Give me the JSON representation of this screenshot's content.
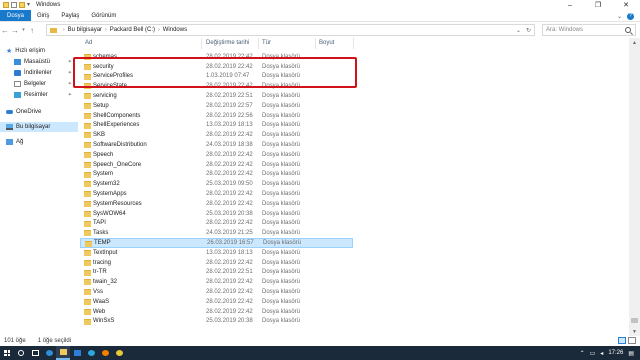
{
  "window": {
    "title": "Windows",
    "minimize_glyph": "–",
    "maximize_glyph": "❐",
    "close_glyph": "✕"
  },
  "ribbon": {
    "tabs": [
      {
        "label": "Dosya"
      },
      {
        "label": "Giriş"
      },
      {
        "label": "Paylaş"
      },
      {
        "label": "Görünüm"
      }
    ],
    "expand_glyph": "⌄",
    "help_glyph": "?"
  },
  "address_bar": {
    "crumbs": [
      "Bu bilgisayar",
      "Packard Bell (C:)",
      "Windows"
    ],
    "refresh_glyph": "↻"
  },
  "search": {
    "placeholder": "Ara: Windows"
  },
  "nav_pane": {
    "items": [
      {
        "label": "Hızlı erişim",
        "icon": "star-icon"
      },
      {
        "label": "Masaüstü",
        "icon": "desktop-icon",
        "pinned": true
      },
      {
        "label": "İndirilenler",
        "icon": "downloads-icon",
        "pinned": true
      },
      {
        "label": "Belgeler",
        "icon": "documents-icon",
        "pinned": true
      },
      {
        "label": "Resimler",
        "icon": "pictures-icon",
        "pinned": true
      },
      {
        "label": "OneDrive",
        "icon": "onedrive-icon"
      },
      {
        "label": "Bu bilgisayar",
        "icon": "this-pc-icon",
        "selected": true
      },
      {
        "label": "Ağ",
        "icon": "network-icon"
      }
    ]
  },
  "columns": {
    "name": "Ad",
    "date": "Değiştirme tarihi",
    "type": "Tür",
    "size": "Boyut"
  },
  "files": [
    {
      "name": "schemas",
      "date": "28.02.2019 22:42",
      "type": "Dosya klasörü"
    },
    {
      "name": "security",
      "date": "28.02.2019 22:42",
      "type": "Dosya klasörü"
    },
    {
      "name": "ServiceProfiles",
      "date": "1.03.2019 07:47",
      "type": "Dosya klasörü"
    },
    {
      "name": "ServiceState",
      "date": "28.02.2019 22:42",
      "type": "Dosya klasörü"
    },
    {
      "name": "servicing",
      "date": "28.02.2019 22:51",
      "type": "Dosya klasörü"
    },
    {
      "name": "Setup",
      "date": "28.02.2019 22:57",
      "type": "Dosya klasörü"
    },
    {
      "name": "ShellComponents",
      "date": "28.02.2019 22:56",
      "type": "Dosya klasörü"
    },
    {
      "name": "ShellExperiences",
      "date": "13.03.2019 18:13",
      "type": "Dosya klasörü"
    },
    {
      "name": "SKB",
      "date": "28.02.2019 22:42",
      "type": "Dosya klasörü"
    },
    {
      "name": "SoftwareDistribution",
      "date": "24.03.2019 18:38",
      "type": "Dosya klasörü"
    },
    {
      "name": "Speech",
      "date": "28.02.2019 22:42",
      "type": "Dosya klasörü"
    },
    {
      "name": "Speech_OneCore",
      "date": "28.02.2019 22:42",
      "type": "Dosya klasörü"
    },
    {
      "name": "System",
      "date": "28.02.2019 22:42",
      "type": "Dosya klasörü"
    },
    {
      "name": "System32",
      "date": "25.03.2019 09:50",
      "type": "Dosya klasörü"
    },
    {
      "name": "SystemApps",
      "date": "28.02.2019 22:42",
      "type": "Dosya klasörü"
    },
    {
      "name": "SystemResources",
      "date": "28.02.2019 22:42",
      "type": "Dosya klasörü"
    },
    {
      "name": "SysWOW64",
      "date": "25.03.2019 20:38",
      "type": "Dosya klasörü"
    },
    {
      "name": "TAPI",
      "date": "28.02.2019 22:42",
      "type": "Dosya klasörü"
    },
    {
      "name": "Tasks",
      "date": "24.03.2019 21:25",
      "type": "Dosya klasörü"
    },
    {
      "name": "TEMP",
      "date": "26.03.2019 16:57",
      "type": "Dosya klasörü",
      "selected": true
    },
    {
      "name": "TextInput",
      "date": "13.03.2019 18:13",
      "type": "Dosya klasörü"
    },
    {
      "name": "tracing",
      "date": "28.02.2019 22:42",
      "type": "Dosya klasörü"
    },
    {
      "name": "tr-TR",
      "date": "28.02.2019 22:51",
      "type": "Dosya klasörü"
    },
    {
      "name": "twain_32",
      "date": "28.02.2019 22:42",
      "type": "Dosya klasörü"
    },
    {
      "name": "Vss",
      "date": "28.02.2019 22:42",
      "type": "Dosya klasörü"
    },
    {
      "name": "WaaS",
      "date": "28.02.2019 22:42",
      "type": "Dosya klasörü"
    },
    {
      "name": "Web",
      "date": "28.02.2019 22:42",
      "type": "Dosya klasörü"
    },
    {
      "name": "WinSxS",
      "date": "25.03.2019 20:38",
      "type": "Dosya klasörü"
    }
  ],
  "status": {
    "item_count": "101 öğe",
    "selected": "1 öğe seçildi"
  },
  "taskbar": {
    "time": "17:26",
    "apps": [
      "edge-icon",
      "file-explorer-icon",
      "store-icon",
      "skype-icon",
      "media-player-icon",
      "chrome-icon"
    ]
  },
  "colors": {
    "accent": "#1979ca",
    "selection": "#cce8ff",
    "highlight_box": "#d0121a",
    "folder": "#f0c95c"
  }
}
